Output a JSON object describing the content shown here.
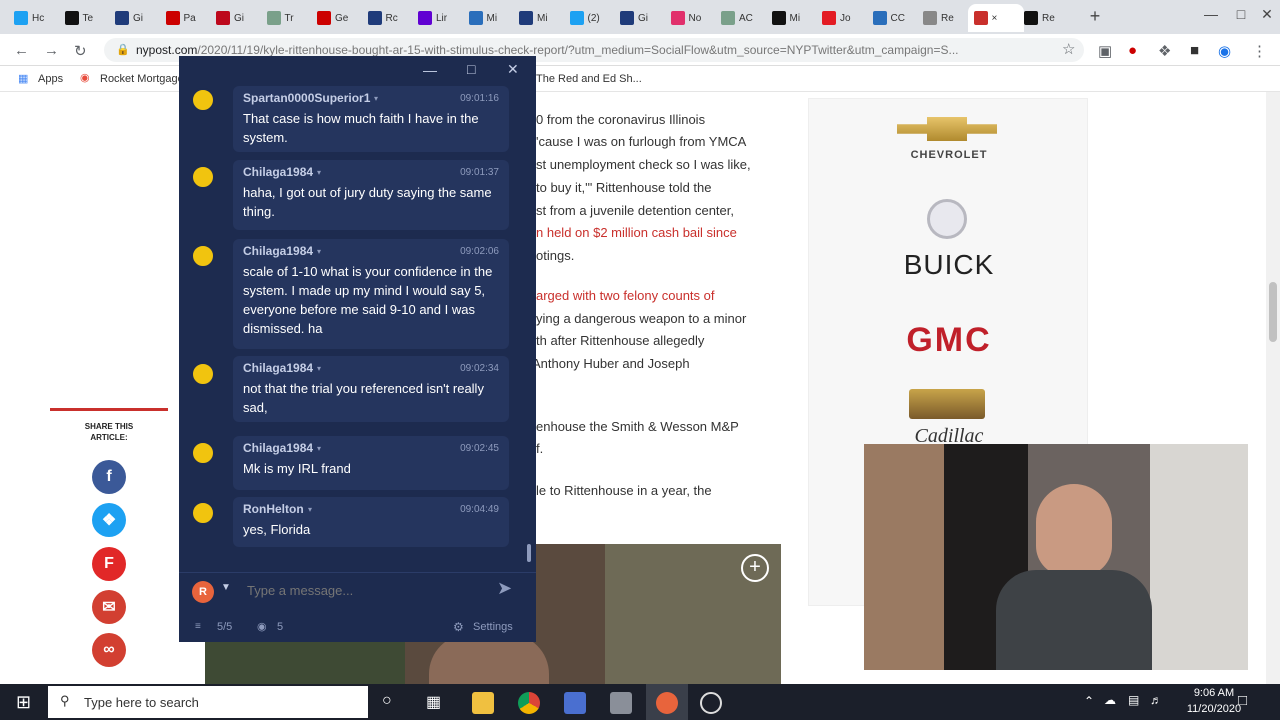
{
  "browser": {
    "tabs": [
      {
        "label": "Hc",
        "icon": "twitter-icon",
        "color": "#1da1f2"
      },
      {
        "label": "Te",
        "icon": "dw-icon",
        "color": "#111111"
      },
      {
        "label": "Gi",
        "icon": "wp-icon",
        "color": "#1f3b7a"
      },
      {
        "label": "Pa",
        "icon": "cnn-icon",
        "color": "#cc0000"
      },
      {
        "label": "Gi",
        "icon": "pinterest-icon",
        "color": "#bd081c"
      },
      {
        "label": "Tr",
        "icon": "page-icon",
        "color": "#7aa08a"
      },
      {
        "label": "Ge",
        "icon": "cnn-icon",
        "color": "#cc0000"
      },
      {
        "label": "Rc",
        "icon": "wp-icon",
        "color": "#1f3b7a"
      },
      {
        "label": "Lir",
        "icon": "yahoo-icon",
        "color": "#6001d2"
      },
      {
        "label": "Mi",
        "icon": "grid-icon",
        "color": "#2a6ebb"
      },
      {
        "label": "Mi",
        "icon": "wp-icon",
        "color": "#1f3b7a"
      },
      {
        "label": "(2)",
        "icon": "twitter-icon",
        "color": "#1da1f2"
      },
      {
        "label": "Gi",
        "icon": "wp-icon",
        "color": "#1f3b7a"
      },
      {
        "label": "No",
        "icon": "instagram-icon",
        "color": "#e1306c"
      },
      {
        "label": "AC",
        "icon": "page-icon",
        "color": "#7aa08a"
      },
      {
        "label": "Mi",
        "icon": "dw-icon",
        "color": "#111111"
      },
      {
        "label": "Jo",
        "icon": "n-icon",
        "color": "#e31b23"
      },
      {
        "label": "CC",
        "icon": "cc-icon",
        "color": "#2a6ebb"
      },
      {
        "label": "Re",
        "icon": "chart-icon",
        "color": "#888888"
      },
      {
        "label": "×",
        "icon": "nypost-icon",
        "color": "#c9302c"
      },
      {
        "label": "Re",
        "icon": "circle-icon",
        "color": "#111111"
      }
    ],
    "new_tab": "+",
    "url_host": "nypost.com",
    "url_path": "/2020/11/19/kyle-rittenhouse-bought-ar-15-with-stimulus-check-report/?utm_medium=SocialFlow&utm_source=NYPTwitter&utm_campaign=S...",
    "bookmarks": [
      "Apps",
      "Rocket Mortgage",
      "The Red and Ed Sh..."
    ]
  },
  "article": {
    "lines": [
      "0 from the coronavirus Illinois",
      "'cause I was on furlough from YMCA",
      "st unemployment check so I was like,",
      "to buy it,'\" Rittenhouse told the",
      "st from a juvenile detention center,",
      "n held on $2 million cash bail since",
      "otings.",
      "arged with two felony counts of",
      "ying a dangerous weapon to a minor",
      "th after Rittenhouse allegedly",
      "Anthony Huber and Joseph",
      "enhouse the Smith & Wesson M&P",
      "f.",
      "le to Rittenhouse in a year, the"
    ],
    "share_label": "SHARE THIS ARTICLE:",
    "share_icons": [
      "facebook-icon",
      "twitter-icon",
      "flipboard-icon",
      "email-icon",
      "link-icon"
    ],
    "ads": [
      "CHEVROLET",
      "BUICK",
      "GMC",
      "Cadillac"
    ]
  },
  "chat": {
    "messages": [
      {
        "user": "Spartan0000Superior1",
        "time": "09:01:16",
        "text": "That case is how much faith I have in the system."
      },
      {
        "user": "Chilaga1984",
        "time": "09:01:37",
        "text": "haha, I got out of jury duty saying the same thing."
      },
      {
        "user": "Chilaga1984",
        "time": "09:02:06",
        "text": "scale of 1-10 what is your confidence in the system. I made up my mind I would say 5, everyone before me said 9-10 and I was dismissed. ha"
      },
      {
        "user": "Chilaga1984",
        "time": "09:02:34",
        "text": "not that the trial you referenced isn't really sad,"
      },
      {
        "user": "Chilaga1984",
        "time": "09:02:45",
        "text": "Mk is my IRL frand"
      },
      {
        "user": "RonHelton",
        "time": "09:04:49",
        "text": "yes, Florida"
      }
    ],
    "input_placeholder": "Type a message...",
    "avatar_letter": "R",
    "stats_slots": "5/5",
    "stats_viewers": "5",
    "settings_label": "Settings"
  },
  "taskbar": {
    "search_placeholder": "Type here to search",
    "time": "9:06 AM",
    "date": "11/20/2020"
  }
}
